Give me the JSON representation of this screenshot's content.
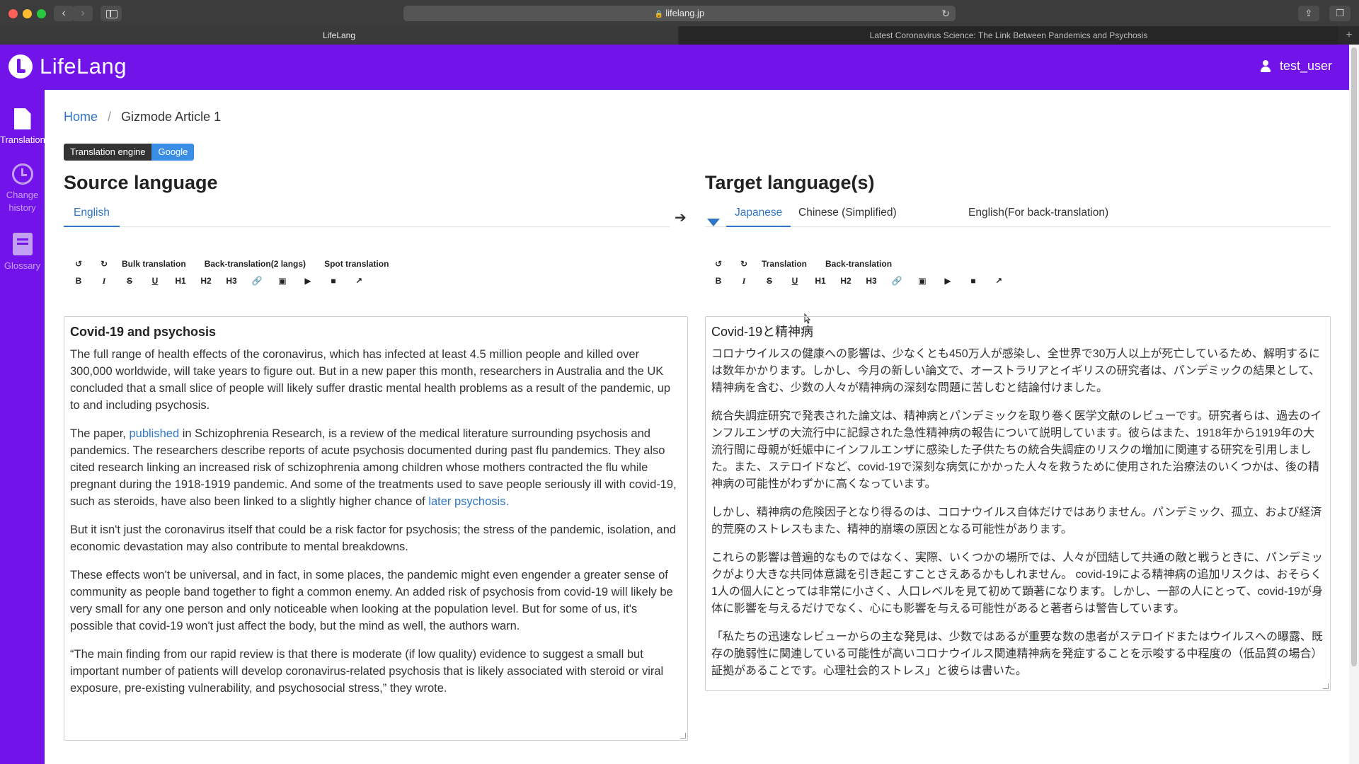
{
  "browser": {
    "url": "lifelang.jp",
    "tabs": [
      "LifeLang",
      "Latest Coronavirus Science: The Link Between Pandemics and Psychosis"
    ]
  },
  "app": {
    "name": "LifeLang",
    "user": "test_user"
  },
  "sidebar": {
    "items": [
      {
        "label": "Translation",
        "icon": "document-icon"
      },
      {
        "label": "Change history",
        "icon": "history-icon"
      },
      {
        "label": "Glossary",
        "icon": "glossary-icon"
      }
    ]
  },
  "breadcrumb": {
    "home": "Home",
    "current": "Gizmode Article 1"
  },
  "engine": {
    "label": "Translation engine",
    "value": "Google"
  },
  "source": {
    "title": "Source language",
    "tabs": [
      "English"
    ],
    "toolbar": {
      "actions": [
        "Bulk translation",
        "Back-translation(2 langs)",
        "Spot translation"
      ],
      "format": [
        "B",
        "I",
        "S",
        "U",
        "H1",
        "H2",
        "H3"
      ]
    },
    "heading": "Covid-19 and psychosis",
    "p1": "The full range of health effects of the coronavirus, which has infected at least 4.5 million people and killed over 300,000 worldwide, will take years to figure out. But in a new paper this month, researchers in Australia and the UK concluded that a small slice of people will likely suffer drastic mental health problems as a result of the pandemic, up to and including psychosis.",
    "p2_a": "The paper, ",
    "p2_link": "published",
    "p2_b": " in Schizophrenia Research, is a review of the medical literature surrounding psychosis and pandemics. The researchers describe reports of acute psychosis documented during past flu pandemics. They also cited research linking an increased risk of schizophrenia among children whose mothers contracted the flu while pregnant during the 1918-1919 pandemic. And some of the treatments used to save people seriously ill with covid-19, such as steroids, have also been linked to a slightly higher chance of ",
    "p2_link2": "later psychosis.",
    "p3": "But it isn't just the coronavirus itself that could be a risk factor for psychosis; the stress of the pandemic, isolation, and economic devastation may also contribute to mental breakdowns.",
    "p4": "These effects won't be universal, and in fact, in some places, the pandemic might even engender a greater sense of community as people band together to fight a common enemy. An added risk of psychosis from covid-19 will likely be very small for any one person and only noticeable when looking at the population level. But for some of us, it's possible that covid-19 won't just affect the body, but the mind as well, the authors warn.",
    "p5": "“The main finding from our rapid review is that there is moderate (if low quality) evidence to suggest a small but important number of patients will develop coronavirus-related psychosis that is likely associated with steroid or viral exposure, pre-existing vulnerability, and psychosocial stress,” they wrote."
  },
  "target": {
    "title": "Target language(s)",
    "tabs": [
      "Japanese",
      "Chinese (Simplified)",
      "English(For back-translation)"
    ],
    "active_tab": "Japanese",
    "toolbar": {
      "actions": [
        "Translation",
        "Back-translation"
      ],
      "format": [
        "B",
        "I",
        "S",
        "U",
        "H1",
        "H2",
        "H3"
      ]
    },
    "heading": "Covid-19と精神病",
    "p1": "コロナウイルスの健康への影響は、少なくとも450万人が感染し、全世界で30万人以上が死亡しているため、解明するには数年かかります。しかし、今月の新しい論文で、オーストラリアとイギリスの研究者は、パンデミックの結果として、精神病を含む、少数の人々が精神病の深刻な問題に苦しむと結論付けました。",
    "p2": "統合失調症研究で発表された論文は、精神病とパンデミックを取り巻く医学文献のレビューです。研究者らは、過去のインフルエンザの大流行中に記録された急性精神病の報告について説明しています。彼らはまた、1918年から1919年の大流行間に母親が妊娠中にインフルエンザに感染した子供たちの統合失調症のリスクの増加に関連する研究を引用しました。また、ステロイドなど、covid-19で深刻な病気にかかった人々を救うために使用された治療法のいくつかは、後の精神病の可能性がわずかに高くなっています。",
    "p3": "しかし、精神病の危険因子となり得るのは、コロナウイルス自体だけではありません。パンデミック、孤立、および経済的荒廃のストレスもまた、精神的崩壊の原因となる可能性があります。",
    "p4": "これらの影響は普遍的なものではなく、実際、いくつかの場所では、人々が団結して共通の敵と戦うときに、パンデミックがより大きな共同体意識を引き起こすことさえあるかもしれません。 covid-19による精神病の追加リスクは、おそらく1人の個人にとっては非常に小さく、人口レベルを見て初めて顕著になります。しかし、一部の人にとって、covid-19が身体に影響を与えるだけでなく、心にも影響を与える可能性があると著者らは警告しています。",
    "p5": "「私たちの迅速なレビューからの主な発見は、少数ではあるが重要な数の患者がステロイドまたはウイルスへの曝露、既存の脆弱性に関連している可能性が高いコロナウイルス関連精神病を発症することを示唆する中程度の（低品質の場合）証拠があることです。心理社会的ストレス」と彼らは書いた。"
  },
  "colors": {
    "brand": "#7213ea",
    "link": "#2f76c7",
    "engine_badge": "#3a8ee6"
  }
}
